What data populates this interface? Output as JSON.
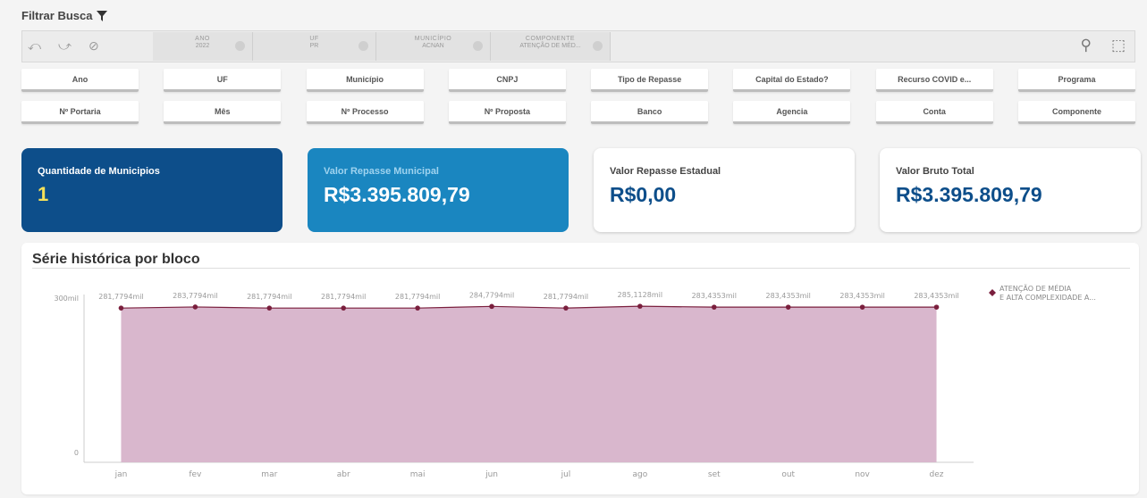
{
  "header": {
    "title": "Filtrar Busca"
  },
  "selections": {
    "chips": [
      {
        "title": "ANO",
        "value": "2022"
      },
      {
        "title": "UF",
        "value": "PR"
      },
      {
        "title": "MUNICÍPIO",
        "value": "ACNAN"
      },
      {
        "title": "COMPONENTE",
        "value": "ATENÇÃO DE MÉD..."
      }
    ]
  },
  "filters": {
    "row1": [
      "Ano",
      "UF",
      "Município",
      "CNPJ",
      "Tipo de Repasse",
      "Capital do Estado?",
      "Recurso COVID e...",
      "Programa"
    ],
    "row2": [
      "Nº Portaria",
      "Mês",
      "Nº Processo",
      "Nº Proposta",
      "Banco",
      "Agencia",
      "Conta",
      "Componente"
    ]
  },
  "kpis": [
    {
      "label": "Quantidade de Municipios",
      "value": "1"
    },
    {
      "label": "Valor Repasse Municipal",
      "value": "R$3.395.809,79"
    },
    {
      "label": "Valor Repasse Estadual",
      "value": "R$0,00"
    },
    {
      "label": "Valor Bruto Total",
      "value": "R$3.395.809,79"
    }
  ],
  "chart": {
    "title": "Série histórica por bloco"
  },
  "chart_data": {
    "type": "area",
    "title": "Série histórica por bloco",
    "categories": [
      "jan",
      "fev",
      "mar",
      "abr",
      "mai",
      "jun",
      "jul",
      "ago",
      "set",
      "out",
      "nov",
      "dez"
    ],
    "series": [
      {
        "name": "ATENÇÃO DE MÉDIA E ALTA COMPLEXIDADE A...",
        "values": [
          281.7794,
          283.7794,
          281.7794,
          281.7794,
          281.7794,
          284.7794,
          281.7794,
          285.1128,
          283.4353,
          283.4353,
          283.4353,
          283.4353
        ],
        "labels": [
          "281,7794mil",
          "283,7794mil",
          "281,7794mil",
          "281,7794mil",
          "281,7794mil",
          "284,7794mil",
          "281,7794mil",
          "285,1128mil",
          "283,4353mil",
          "283,4353mil",
          "283,4353mil",
          "283,4353mil"
        ],
        "color": "#7a1f3d",
        "fill": "#d9b7cd"
      }
    ],
    "yticks": [
      "0",
      "300mil"
    ],
    "ylim": [
      0,
      300
    ],
    "legend": "right",
    "grid": false
  }
}
